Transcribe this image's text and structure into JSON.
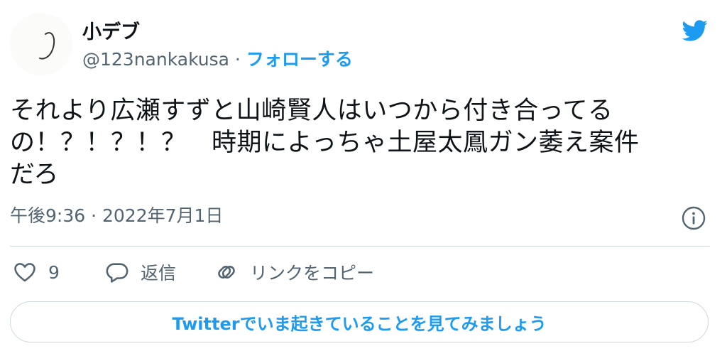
{
  "author": {
    "display_name": "小デブ",
    "handle": "@123nankakusa",
    "separator": " · ",
    "follow_label": "フォローする"
  },
  "tweet": {
    "text": "それより広瀬すずと山崎賢人はいつから付き合ってる\nの！？！？！？　時期によっちゃ土屋太鳳ガン萎え案件\nだろ",
    "timestamp": "午後9:36 · 2022年7月1日"
  },
  "actions": {
    "like_count": "9",
    "reply_label": "返信",
    "copy_link_label": "リンクをコピー"
  },
  "cta": {
    "label": "Twitterでいま起きていることを見てみましょう"
  },
  "colors": {
    "accent": "#1d9bf0",
    "secondary_text": "#536471",
    "border": "#cfd9de"
  },
  "icons": [
    "twitter-bird-icon",
    "info-icon",
    "heart-icon",
    "reply-icon",
    "link-icon"
  ]
}
